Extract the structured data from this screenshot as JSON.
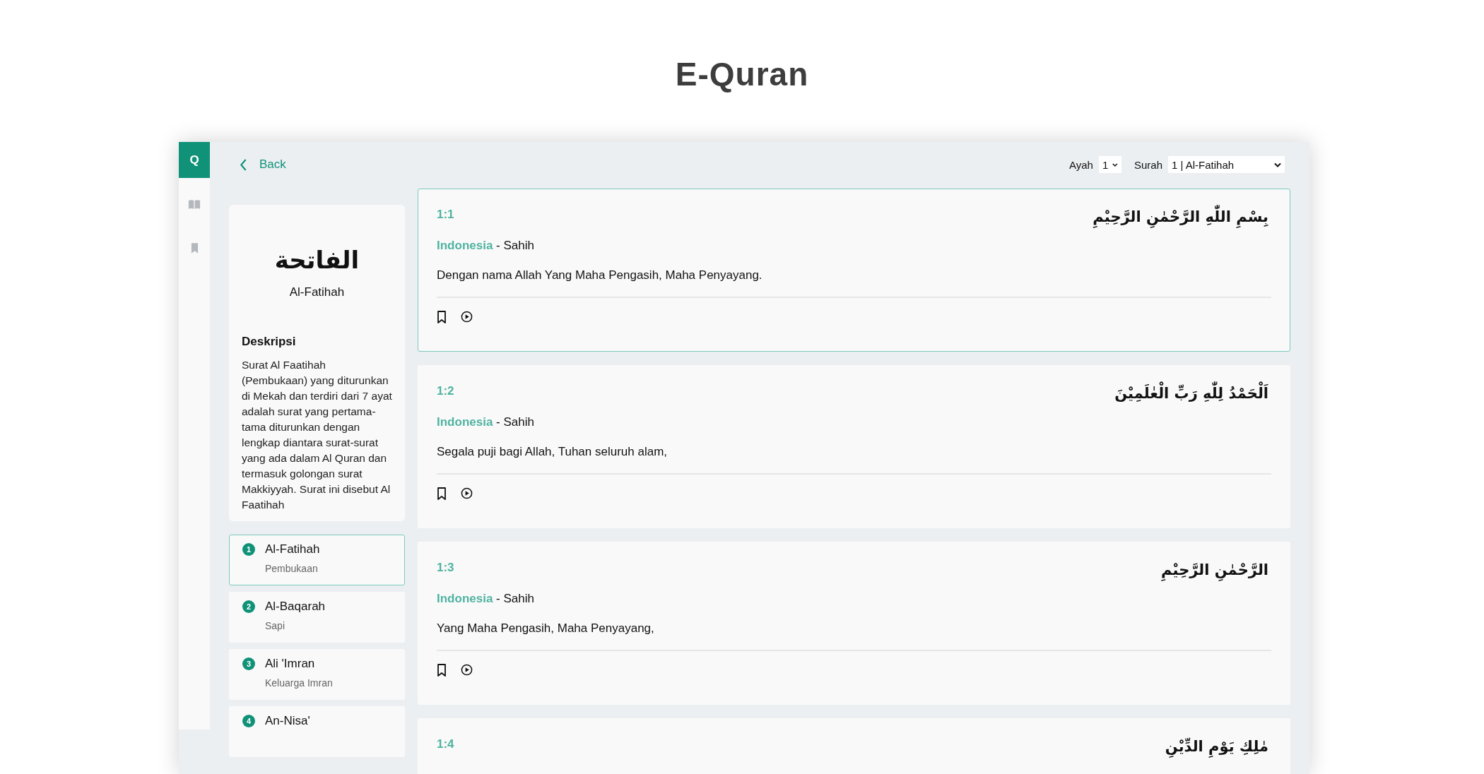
{
  "page_title": "E-Quran",
  "app": {
    "logo": "Q",
    "back": "Back",
    "ayah_select": {
      "label": "Ayah",
      "value": "1"
    },
    "surah_select": {
      "label": "Surah",
      "value": "1 | Al-Fatihah"
    },
    "surah_info": {
      "arabic": "الفاتحة",
      "name": "Al-Fatihah",
      "description_heading": "Deskripsi",
      "description": "Surat Al Faatihah (Pembukaan) yang diturunkan di Mekah dan terdiri dari 7 ayat adalah surat yang pertama-tama diturunkan dengan lengkap diantara surat-surat yang ada dalam Al Quran dan termasuk golongan surat Makkiyyah. Surat ini disebut Al Faatihah"
    },
    "surah_list": [
      {
        "number": "1",
        "name": "Al-Fatihah",
        "meaning": "Pembukaan",
        "selected": true
      },
      {
        "number": "2",
        "name": "Al-Baqarah",
        "meaning": "Sapi",
        "selected": false
      },
      {
        "number": "3",
        "name": "Ali 'Imran",
        "meaning": "Keluarga Imran",
        "selected": false
      },
      {
        "number": "4",
        "name": "An-Nisa'",
        "selected": false
      }
    ],
    "verses": [
      {
        "ref": "1:1",
        "arabic": "بِسْمِ اللّٰهِ الرَّحْمٰنِ الرَّحِيْمِ",
        "language": "Indonesia",
        "source": "- Sahih",
        "translation": "Dengan nama Allah Yang Maha Pengasih, Maha Penyayang.",
        "selected": true
      },
      {
        "ref": "1:2",
        "arabic": "اَلْحَمْدُ لِلّٰهِ رَبِّ الْعٰلَمِيْنَ",
        "language": "Indonesia",
        "source": "- Sahih",
        "translation": "Segala puji bagi Allah, Tuhan seluruh alam,",
        "selected": false
      },
      {
        "ref": "1:3",
        "arabic": "الرَّحْمٰنِ الرَّحِيْمِ",
        "language": "Indonesia",
        "source": "- Sahih",
        "translation": "Yang Maha Pengasih, Maha Penyayang,",
        "selected": false
      },
      {
        "ref": "1:4",
        "arabic": "مٰلِكِ يَوْمِ الدِّيْنِ",
        "selected": false
      }
    ]
  }
}
